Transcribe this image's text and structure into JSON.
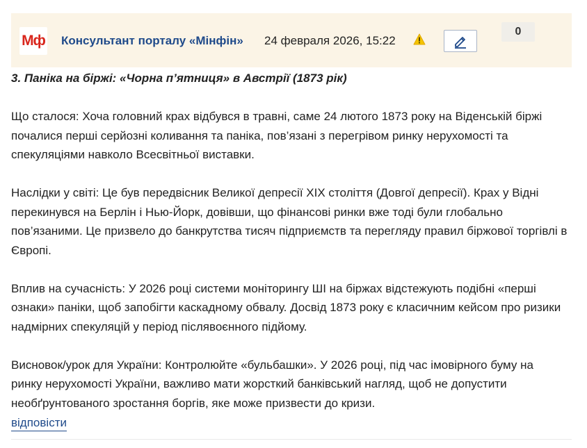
{
  "comment": {
    "logo_text": "Мф",
    "author": "Консультант порталу «Мінфін»",
    "date": "24 февраля 2026, 15:22",
    "warning_icon": "warning-icon",
    "edit_icon": "pencil-icon",
    "likes_count": "0",
    "colors": {
      "header_bg": "#fbf4e6",
      "author": "#1f4a8a",
      "logo": "#d9261c",
      "warning": "#f5c400",
      "link": "#1f4a8a"
    },
    "paragraphs": [
      "3. Паніка на біржі: «Чорна п’ятниця» в Австрії (1873 рік)",
      "Що сталося: Хоча головний крах відбувся в травні, саме 24 лютого 1873 року на Віденській біржі почалися перші серйозні коливання та паніка, пов’язані з перегрівом ринку нерухомості та спекуляціями навколо Всесвітньої виставки.",
      "Наслідки у світі: Це був передвісник Великої депресії XIX століття (Довгої депресії). Крах у Відні перекинувся на Берлін і Нью-Йорк, довівши, що фінансові ринки вже тоді були глобально пов’язаними. Це призвело до банкрутства тисяч підприємств та перегляду правил біржової торгівлі в Європі.",
      "Вплив на сучасність: У 2026 році системи моніторингу ШІ на біржах відстежують подібні «перші ознаки» паніки, щоб запобігти каскадному обвалу. Досвід 1873 року є класичним кейсом про ризики надмірних спекуляцій у період післявоєнного підйому.",
      "Висновок/урок для України: Контролюйте «бульбашки». У 2026 році, під час імовірного буму на ринку нерухомості України, важливо мати жорсткий банківський нагляд, щоб не допустити необґрунтованого зростання боргів, яке може призвести до кризи."
    ],
    "reply_label": "відповісти"
  }
}
